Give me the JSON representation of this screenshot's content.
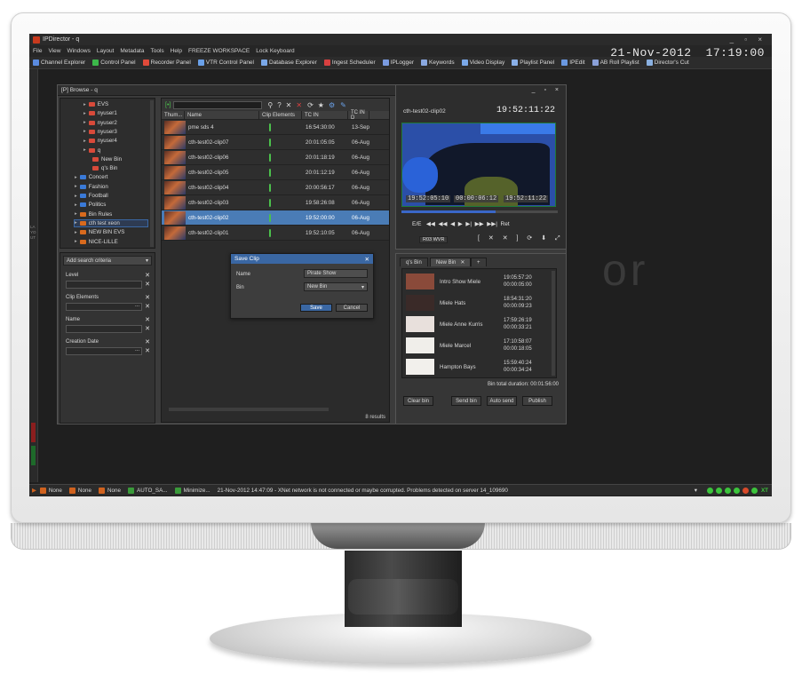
{
  "app": {
    "title": "IPDirector - q",
    "date": "21-Nov-2012",
    "time": "17:19:00",
    "window_controls": "_ ▫ ×"
  },
  "menu": [
    "File",
    "View",
    "Windows",
    "Layout",
    "Metadata",
    "Tools",
    "Help",
    "FREEZE WORKSPACE",
    "Lock Keyboard"
  ],
  "toolbar": [
    {
      "label": "Channel Explorer",
      "color": "#5a8be0"
    },
    {
      "label": "Control Panel",
      "color": "#3cb84a"
    },
    {
      "label": "Recorder Panel",
      "color": "#e04a3a"
    },
    {
      "label": "VTR Control Panel",
      "color": "#6aa0e8"
    },
    {
      "label": "Database Explorer",
      "color": "#7aa8e8"
    },
    {
      "label": "Ingest Scheduler",
      "color": "#d84040"
    },
    {
      "label": "IPLogger",
      "color": "#7a9be0"
    },
    {
      "label": "Keywords",
      "color": "#8aa8e0"
    },
    {
      "label": "Video Display",
      "color": "#7aa8e8"
    },
    {
      "label": "Playlist Panel",
      "color": "#8ab0e8"
    },
    {
      "label": "IPEdit",
      "color": "#6a98e0"
    },
    {
      "label": "AB Roll Playlist",
      "color": "#8aa0d8"
    },
    {
      "label": "Director's Cut",
      "color": "#8ab0e0"
    }
  ],
  "side_strip": {
    "label": "LAYOUT"
  },
  "browse": {
    "title": "[P] Browse - q",
    "tree": [
      {
        "label": "EVS",
        "color": "#d84a3a",
        "indent": 1
      },
      {
        "label": "nyuser1",
        "color": "#d84a3a",
        "indent": 1
      },
      {
        "label": "nyuser2",
        "color": "#d84a3a",
        "indent": 1
      },
      {
        "label": "nyuser3",
        "color": "#d84a3a",
        "indent": 1
      },
      {
        "label": "nyuser4",
        "color": "#d84a3a",
        "indent": 1
      },
      {
        "label": "q",
        "color": "#d84a3a",
        "indent": 1
      },
      {
        "label": "New Bin",
        "color": "#d84a3a",
        "indent": 2
      },
      {
        "label": "q's Bin",
        "color": "#d84a3a",
        "indent": 2
      },
      {
        "label": "Concert",
        "color": "#3a7ad8",
        "indent": 0
      },
      {
        "label": "Fashion",
        "color": "#3a7ad8",
        "indent": 0
      },
      {
        "label": "Football",
        "color": "#3a7ad8",
        "indent": 0
      },
      {
        "label": "Politics",
        "color": "#3a7ad8",
        "indent": 0
      },
      {
        "label": "Bin Rules",
        "color": "#d86a1e",
        "indent": 0
      },
      {
        "label": "cth test xeon",
        "color": "#d86a1e",
        "indent": 0
      },
      {
        "label": "NEW BIN EVS",
        "color": "#d86a1e",
        "indent": 0
      },
      {
        "label": "NICE-LILLE",
        "color": "#d86a1e",
        "indent": 0
      }
    ],
    "search": {
      "add_label": "Add search criteria",
      "fields": [
        {
          "label": "Level",
          "value": ""
        },
        {
          "label": "Clip Elements",
          "value": "..."
        },
        {
          "label": "Name",
          "value": ""
        },
        {
          "label": "Creation Date",
          "value": "..."
        }
      ]
    },
    "grid": {
      "columns": [
        "Thum...",
        "Name",
        "Clip Elements",
        "TC IN",
        "TC IN D"
      ],
      "rows": [
        {
          "name": "pme sds 4",
          "tc_in": "16:54:30:00",
          "date": "13-Sep"
        },
        {
          "name": "cth-test02-clip07",
          "tc_in": "20:01:05:05",
          "date": "06-Aug"
        },
        {
          "name": "cth-test02-clip06",
          "tc_in": "20:01:18:19",
          "date": "06-Aug"
        },
        {
          "name": "cth-test02-clip05",
          "tc_in": "20:01:12:19",
          "date": "06-Aug"
        },
        {
          "name": "cth-test02-clip04",
          "tc_in": "20:00:56:17",
          "date": "06-Aug"
        },
        {
          "name": "cth-test02-clip03",
          "tc_in": "19:58:26:08",
          "date": "06-Aug"
        },
        {
          "name": "cth-test02-clip02",
          "tc_in": "19:52:00:00",
          "date": "06-Aug",
          "selected": true
        },
        {
          "name": "cth-test02-clip01",
          "tc_in": "19:52:10:05",
          "date": "06-Aug"
        }
      ],
      "results": "8 results"
    }
  },
  "dialog": {
    "title": "Save Clip",
    "name_label": "Name",
    "name_value": "Pirate Show",
    "bin_label": "Bin",
    "bin_value": "New Bin",
    "save": "Save",
    "cancel": "Cancel"
  },
  "player": {
    "clip_name": "cth-test02-clip02",
    "timecode": "19:52:11:22",
    "tc_in": "19:52:05:10",
    "duration": "00:00:06:12",
    "tc_out": "19:52:11:22",
    "speed": "R03 WVR",
    "scrub_position": 0.6,
    "transport": "E/E   ◀◀  ◀◀  ◀  ▶  ▶|  ▶▶  ▶▶|  Ret"
  },
  "bin": {
    "tabs": [
      "q's Bin",
      "New Bin"
    ],
    "items": [
      {
        "name": "Intro Show Miele",
        "tc": "19:05:57:20",
        "dur": "00:00:05:00",
        "thumb": "#8a4a3a"
      },
      {
        "name": "Miele Hats",
        "tc": "18:54:31:20",
        "dur": "00:00:09:23",
        "thumb": "#3a2a28"
      },
      {
        "name": "Miele Anne Kurris",
        "tc": "17:59:26:19",
        "dur": "00:00:33:21",
        "thumb": "#e8e0dc"
      },
      {
        "name": "Miele Marcel",
        "tc": "17:10:58:07",
        "dur": "00:00:18:05",
        "thumb": "#f0eeea"
      },
      {
        "name": "Hampton Bays",
        "tc": "15:59:40:24",
        "dur": "00:00:34:24",
        "thumb": "#f2f0ec"
      }
    ],
    "total": "Bin total duration: 00:01:56:00",
    "buttons": [
      "Clear bin",
      "Send bin",
      "Auto send",
      "Publish"
    ]
  },
  "watermark": "or",
  "status": {
    "items": [
      "None",
      "None",
      "None",
      "AUTO_SA...",
      "Minimize..."
    ],
    "message": "21-Nov-2012 14:47:09 - XNet network is not connected or maybe corrupted.  Problems detected on server 14_109690",
    "icons": "XT"
  }
}
